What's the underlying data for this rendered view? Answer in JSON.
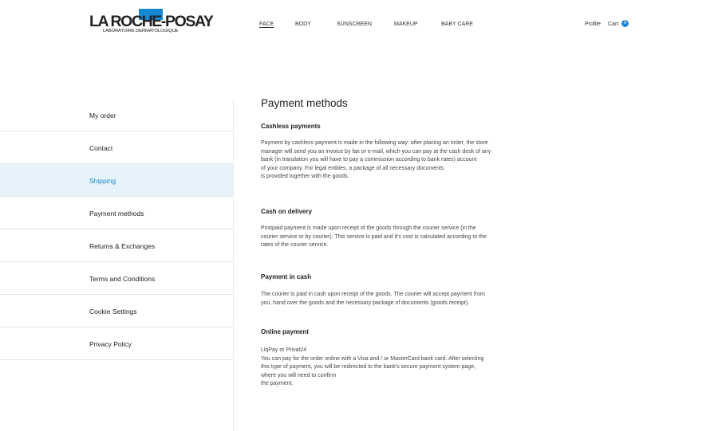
{
  "brand": {
    "name": "LA ROCHE-POSAY",
    "subtitle": "LABORATOIRE DERMATOLOGIQUE"
  },
  "nav": {
    "items": [
      {
        "label": "FACE",
        "active": true
      },
      {
        "label": "BODY",
        "active": false
      },
      {
        "label": "SUNSCREEN",
        "active": false
      },
      {
        "label": "MAKEUP",
        "active": false
      },
      {
        "label": "BABY CARE",
        "active": false
      }
    ]
  },
  "user": {
    "profile_label": "Profile",
    "cart_label": "Cart",
    "cart_count": "0"
  },
  "sidebar": {
    "items": [
      {
        "label": "My order",
        "active": false
      },
      {
        "label": "Contact",
        "active": false
      },
      {
        "label": "Shipping",
        "active": true
      },
      {
        "label": "Payment methods",
        "active": false
      },
      {
        "label": "Returns & Exchanges",
        "active": false
      },
      {
        "label": "Terms and Conditions",
        "active": false
      },
      {
        "label": "Cookie Settings",
        "active": false
      },
      {
        "label": "Privacy Policy",
        "active": false
      }
    ]
  },
  "content": {
    "title": "Payment methods",
    "sections": [
      {
        "heading": "Cashless payments",
        "text": "Payment by cashless payment is made in the following way: after placing an order, the store\nmanager will send you an invoice by fax or e-mail, which you can pay at the cash desk of any\nbank (in translation you will have to pay a commission according to bank rates) account\nof your company. For legal entities, a package of all necessary documents\nis provided together with the goods."
      },
      {
        "heading": "Cash on delivery",
        "text": "Postpaid payment is made upon receipt of the goods through the courier service (in the\ncourier service or by courier). This service is paid and it's cost is calculated according to the\nrates of the courier service."
      },
      {
        "heading": "Payment in cash",
        "text": "The courier is paid in cash upon receipt of the goods. The courier will accept payment from\nyou, hand over the goods and the necessary package of documents (goods receipt)."
      },
      {
        "heading": "Online payment",
        "text": "LiqPay or Privat24\nYou can pay for the order online with a Visa and / or MasterCard bank card. After selecting\nthis type of payment, you will be redirected to the bank's secure payment system page,\nwhere you will need to confirm\nthe payment."
      }
    ]
  },
  "colors": {
    "accent": "#1b8acb",
    "active_bg": "#e6f3fa",
    "logo_square": "#1489cf"
  }
}
